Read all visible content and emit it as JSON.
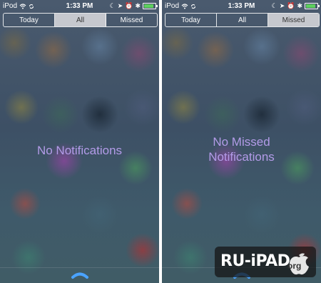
{
  "screens": [
    {
      "status": {
        "carrier": "iPod",
        "time": "1:33 PM"
      },
      "tabs": [
        {
          "label": "Today",
          "active": false
        },
        {
          "label": "All",
          "active": true
        },
        {
          "label": "Missed",
          "active": false
        }
      ],
      "message": "No Notifications"
    },
    {
      "status": {
        "carrier": "iPod",
        "time": "1:33 PM"
      },
      "tabs": [
        {
          "label": "Today",
          "active": false
        },
        {
          "label": "All",
          "active": false
        },
        {
          "label": "Missed",
          "active": true
        }
      ],
      "message_lines": [
        "No Missed",
        "Notifications"
      ]
    }
  ],
  "watermark": {
    "text": "RU-iPAD",
    "suffix": "org"
  },
  "colors": {
    "message": "#b39be8",
    "battery": "#5ed05e",
    "segment_active": "#d7d7dc"
  },
  "icons": [
    "wifi-icon",
    "sync-icon",
    "moon-icon",
    "location-arrow-icon",
    "alarm-icon",
    "bluetooth-icon",
    "battery-icon",
    "chevron-up-handle-icon",
    "apple-logo-icon"
  ]
}
